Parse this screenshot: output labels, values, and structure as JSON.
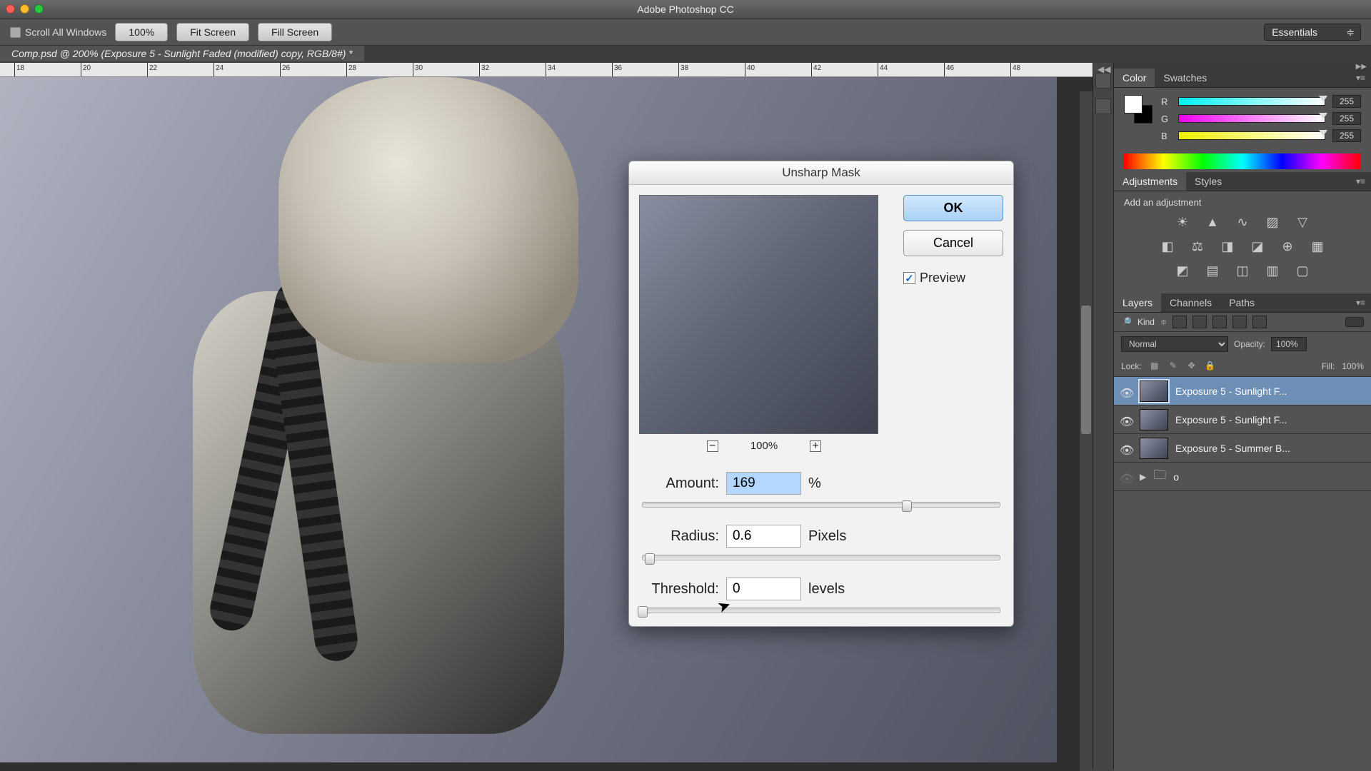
{
  "app_title": "Adobe Photoshop CC",
  "options_bar": {
    "scroll_all": "Scroll All Windows",
    "btn_100": "100%",
    "btn_fit": "Fit Screen",
    "btn_fill": "Fill Screen",
    "workspace": "Essentials"
  },
  "document_tab": "Comp.psd @ 200% (Exposure 5 - Sunlight Faded (modified) copy, RGB/8#) *",
  "ruler_ticks": [
    "18",
    "20",
    "22",
    "24",
    "26",
    "28",
    "30",
    "32",
    "34",
    "36",
    "38",
    "40",
    "42",
    "44",
    "46",
    "48"
  ],
  "dialog": {
    "title": "Unsharp Mask",
    "ok": "OK",
    "cancel": "Cancel",
    "preview": "Preview",
    "zoom": "100%",
    "amount_label": "Amount:",
    "amount_value": "169",
    "amount_unit": "%",
    "radius_label": "Radius:",
    "radius_value": "0.6",
    "radius_unit": "Pixels",
    "threshold_label": "Threshold:",
    "threshold_value": "0",
    "threshold_unit": "levels"
  },
  "panels": {
    "color_tab": "Color",
    "swatches_tab": "Swatches",
    "r_label": "R",
    "g_label": "G",
    "b_label": "B",
    "r_val": "255",
    "g_val": "255",
    "b_val": "255",
    "adjustments_tab": "Adjustments",
    "styles_tab": "Styles",
    "add_adjustment": "Add an adjustment",
    "layers_tab": "Layers",
    "channels_tab": "Channels",
    "paths_tab": "Paths",
    "kind_label": "Kind",
    "blend_mode": "Normal",
    "opacity_label": "Opacity:",
    "opacity_val": "100%",
    "lock_label": "Lock:",
    "fill_label": "Fill:",
    "fill_val": "100%",
    "layers": [
      {
        "name": "Exposure 5 - Sunlight F...",
        "selected": true
      },
      {
        "name": "Exposure 5 - Sunlight F...",
        "selected": false
      },
      {
        "name": "Exposure 5 - Summer B...",
        "selected": false
      }
    ],
    "folder_name": "o"
  }
}
